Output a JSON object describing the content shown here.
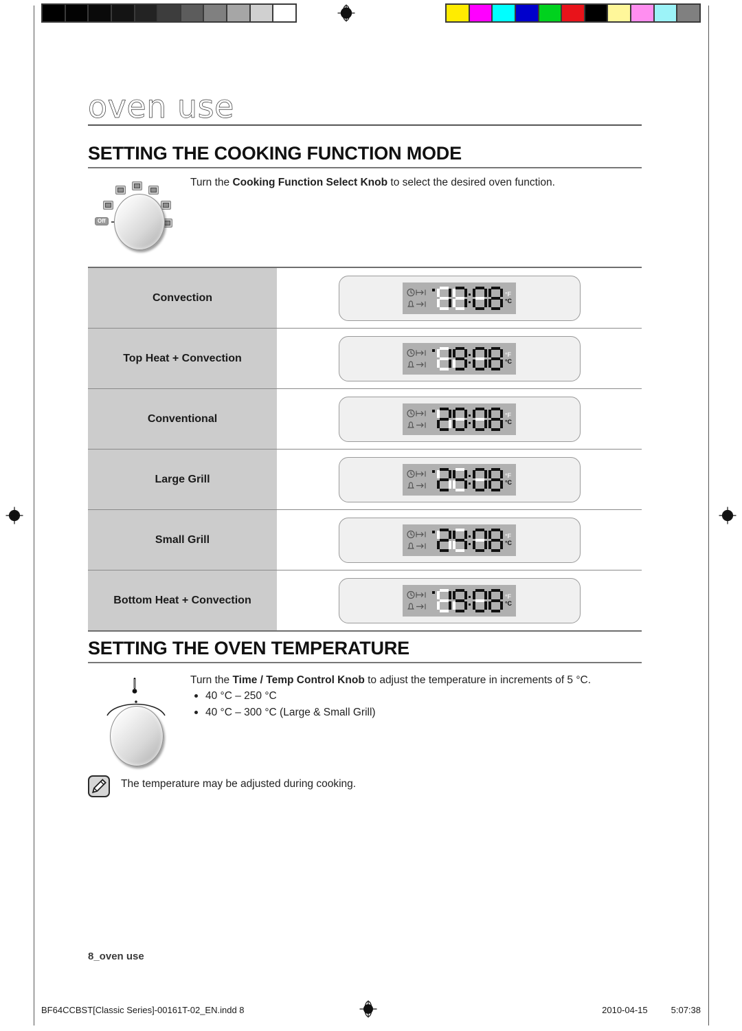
{
  "calibration": {
    "gray_bar": [
      "#000000",
      "#030303",
      "#0a0a0a",
      "#141414",
      "#232323",
      "#3d3d3d",
      "#5c5c5c",
      "#808080",
      "#a6a6a6",
      "#d0d0d0",
      "#ffffff"
    ],
    "color_bar": [
      "#ffec00",
      "#ff00ff",
      "#00ffff",
      "#0000cc",
      "#00d21e",
      "#e8131a",
      "#000000",
      "#fff79a",
      "#ff8ef0",
      "#9cf3f8",
      "#808080"
    ],
    "registration_icon": "registration-target-icon"
  },
  "chapter": {
    "title": "oven use"
  },
  "sections": [
    {
      "heading": "SETTING THE COOKING FUNCTION MODE",
      "intro_prefix": "Turn the ",
      "intro_bold": "Cooking Function Select Knob",
      "intro_suffix": " to select the desired oven function."
    },
    {
      "heading": "SETTING THE OVEN TEMPERATURE",
      "intro_prefix": "Turn the ",
      "intro_bold": "Time / Temp Control Knob",
      "intro_suffix": " to adjust the temperature in increments of 5 °C.",
      "bullets": [
        "40 °C – 250 °C",
        "40 °C – 300 °C (Large & Small Grill)"
      ]
    }
  ],
  "knob_selector": {
    "off_label": "Off"
  },
  "mode_table": {
    "rows": [
      {
        "label": "Convection",
        "display": "170",
        "unit_f": "°F",
        "unit_c": "°C"
      },
      {
        "label": "Top Heat + Convection",
        "display": "190",
        "unit_f": "°F",
        "unit_c": "°C"
      },
      {
        "label": "Conventional",
        "display": "200",
        "unit_f": "°F",
        "unit_c": "°C"
      },
      {
        "label": "Large Grill",
        "display": "240",
        "unit_f": "°F",
        "unit_c": "°C"
      },
      {
        "label": "Small Grill",
        "display": "240",
        "unit_f": "°F",
        "unit_c": "°C"
      },
      {
        "label": "Bottom Heat + Convection",
        "display": "190",
        "unit_f": "°F",
        "unit_c": "°C"
      }
    ]
  },
  "note": {
    "icon": "note-pen-icon",
    "text": "The temperature may be adjusted during cooking."
  },
  "folio": "8_oven use",
  "tech_footer": {
    "filename": "BF64CCBST[Classic Series]-00161T-02_EN.indd   8",
    "date": "2010-04-15",
    "time": "5:07:38"
  }
}
